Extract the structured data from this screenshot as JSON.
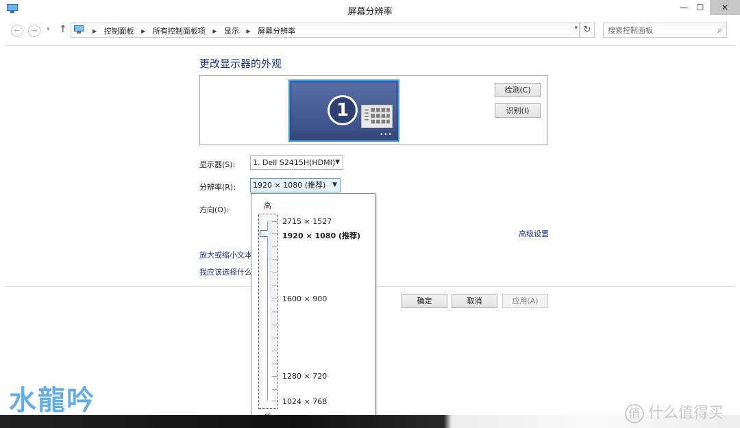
{
  "window": {
    "title": "屏幕分辨率",
    "minimize": "—",
    "maximize": "☐",
    "close": "✕"
  },
  "nav": {
    "back": "←",
    "forward": "→",
    "dropdown": "▾",
    "up": "↑",
    "refresh": "↻"
  },
  "breadcrumbs": [
    "控制面板",
    "所有控制面板项",
    "显示",
    "屏幕分辨率"
  ],
  "breadcrumb_sep": "▶",
  "search": {
    "placeholder": "搜索控制面板",
    "icon": "⌕"
  },
  "heading": "更改显示器的外观",
  "monitor": {
    "number": "1",
    "dots": "•••"
  },
  "buttons": {
    "detect": "检测(C)",
    "identify": "识别(I)",
    "ok": "确定",
    "cancel": "取消",
    "apply": "应用(A)"
  },
  "fields": {
    "display_label": "显示器(S):",
    "display_value": "1. Dell S2415H(HDMI)",
    "resolution_label": "分辨率(R):",
    "resolution_value": "1920 × 1080 (推荐)",
    "orientation_label": "方向(O):"
  },
  "links": {
    "advanced": "高级设置",
    "enlarge": "放大或缩小文本",
    "which": "我应该选择什么"
  },
  "dropdown": {
    "high": "高",
    "low": "低",
    "options": [
      "2715 × 1527",
      "1920 × 1080 (推荐)",
      "1600 × 900",
      "1280 × 720",
      "1024 × 768"
    ],
    "selected_index": 1
  },
  "watermarks": {
    "left": "水龍吟",
    "right": "什么值得买",
    "right_badge": "值"
  },
  "colors": {
    "link": "#1e3287",
    "accent": "#39a1ea",
    "close_bg": "#c7c7c7"
  }
}
